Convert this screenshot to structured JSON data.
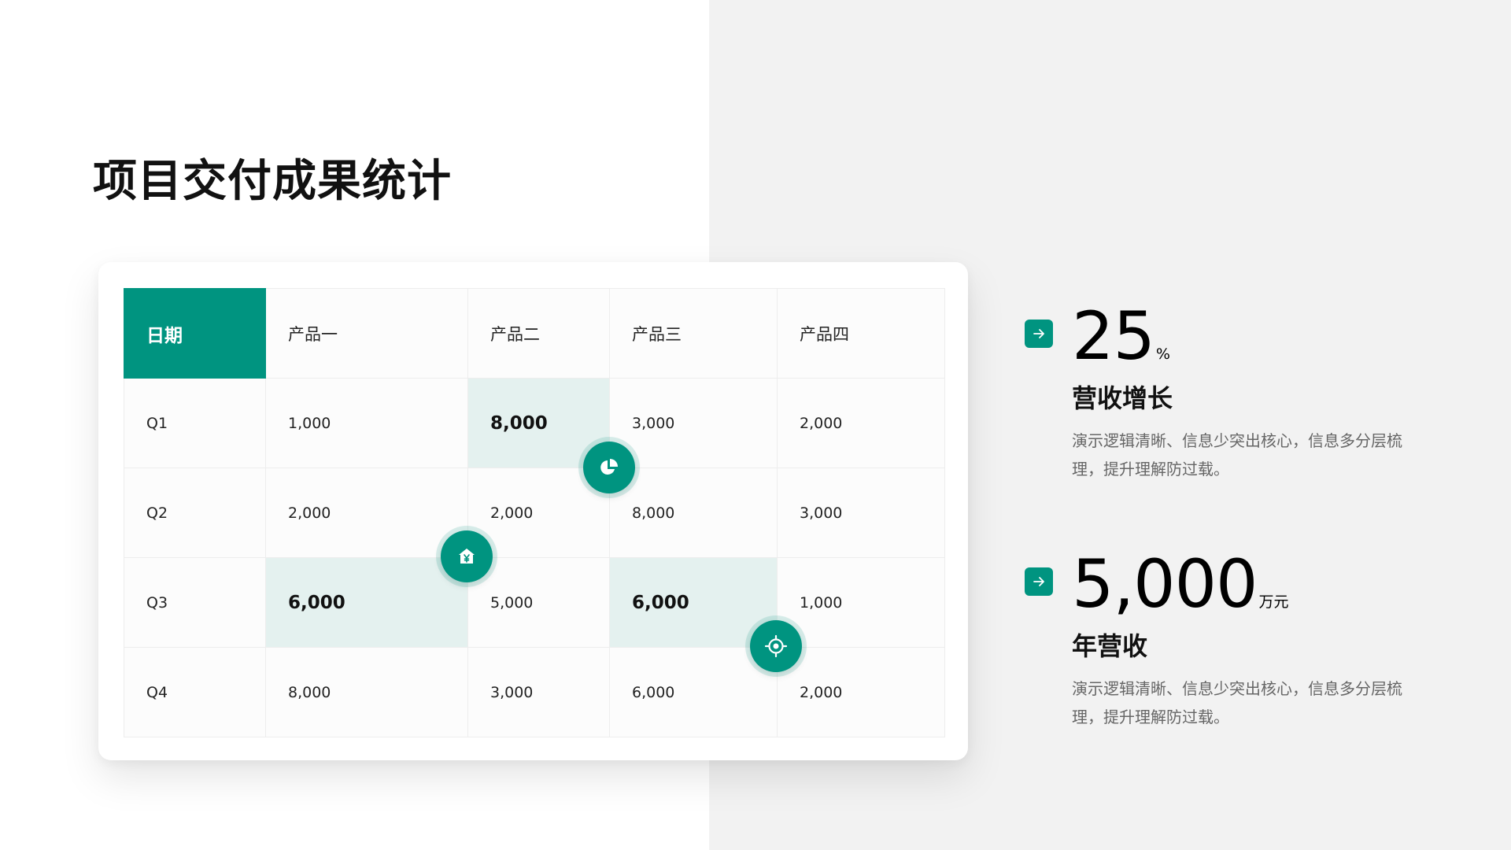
{
  "page": {
    "title": "项目交付成果统计"
  },
  "table": {
    "headers": [
      "日期",
      "产品一",
      "产品二",
      "产品三",
      "产品四"
    ],
    "rows": [
      [
        "Q1",
        "1,000",
        "8,000",
        "3,000",
        "2,000"
      ],
      [
        "Q2",
        "2,000",
        "2,000",
        "8,000",
        "3,000"
      ],
      [
        "Q3",
        "6,000",
        "5,000",
        "6,000",
        "1,000"
      ],
      [
        "Q4",
        "8,000",
        "3,000",
        "6,000",
        "2,000"
      ]
    ]
  },
  "badges": [
    {
      "icon": "pie-chart-icon"
    },
    {
      "icon": "yen-house-icon"
    },
    {
      "icon": "target-icon"
    }
  ],
  "stats": [
    {
      "value": "25",
      "unit": "%",
      "label": "营收增长",
      "desc": "演示逻辑清晰、信息少突出核心，信息多分层梳理，提升理解防过载。",
      "icon": "arrow-right-icon"
    },
    {
      "value": "5,000",
      "unit": "万元",
      "label": "年营收",
      "desc": "演示逻辑清晰、信息少突出核心，信息多分层梳理，提升理解防过载。",
      "icon": "arrow-right-icon"
    }
  ],
  "colors": {
    "accent": "#009480",
    "highlight": "#e4f1ef",
    "panel": "#f2f2f2"
  }
}
